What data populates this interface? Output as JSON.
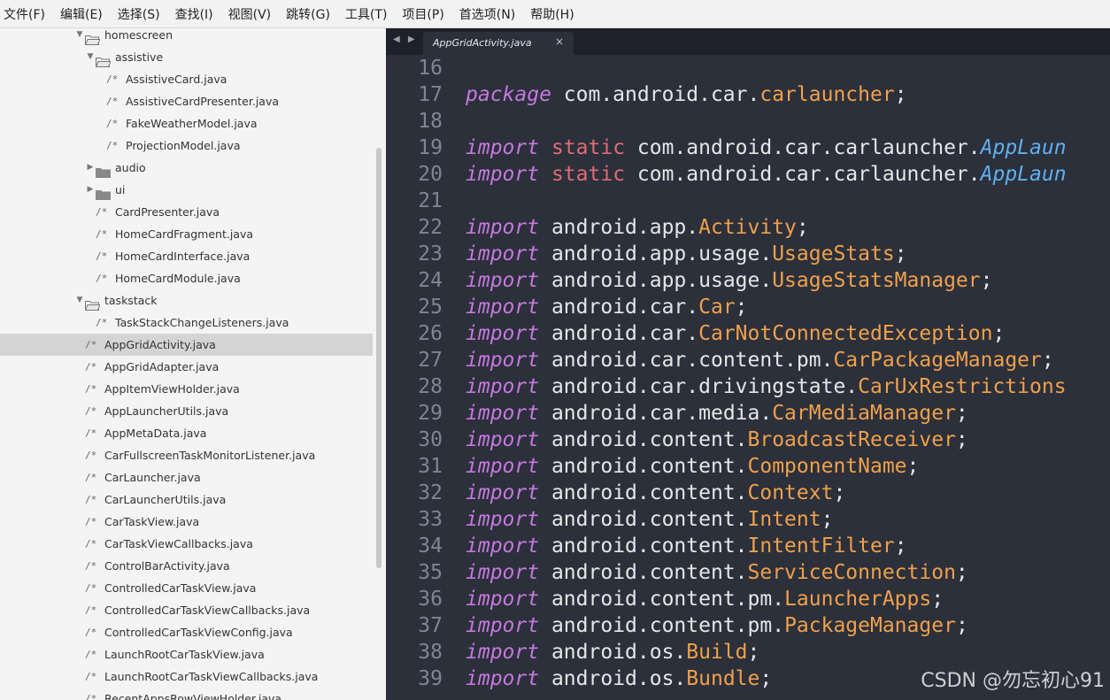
{
  "menu": [
    "文件(F)",
    "编辑(E)",
    "选择(S)",
    "查找(I)",
    "视图(V)",
    "跳转(G)",
    "工具(T)",
    "项目(P)",
    "首选项(N)",
    "帮助(H)"
  ],
  "sidebar": {
    "items": [
      {
        "type": "folder",
        "label": "homescreen",
        "indent": 1,
        "expanded": true
      },
      {
        "type": "folder",
        "label": "assistive",
        "indent": 2,
        "expanded": true
      },
      {
        "type": "file",
        "label": "AssistiveCard.java",
        "indent": 3
      },
      {
        "type": "file",
        "label": "AssistiveCardPresenter.java",
        "indent": 3
      },
      {
        "type": "file",
        "label": "FakeWeatherModel.java",
        "indent": 3
      },
      {
        "type": "file",
        "label": "ProjectionModel.java",
        "indent": 3
      },
      {
        "type": "folder",
        "label": "audio",
        "indent": 2,
        "expanded": false
      },
      {
        "type": "folder",
        "label": "ui",
        "indent": 2,
        "expanded": false
      },
      {
        "type": "file",
        "label": "CardPresenter.java",
        "indent": 2
      },
      {
        "type": "file",
        "label": "HomeCardFragment.java",
        "indent": 2
      },
      {
        "type": "file",
        "label": "HomeCardInterface.java",
        "indent": 2
      },
      {
        "type": "file",
        "label": "HomeCardModule.java",
        "indent": 2
      },
      {
        "type": "folder",
        "label": "taskstack",
        "indent": 1,
        "expanded": true
      },
      {
        "type": "file",
        "label": "TaskStackChangeListeners.java",
        "indent": 2
      },
      {
        "type": "file",
        "label": "AppGridActivity.java",
        "indent": 1,
        "selected": true
      },
      {
        "type": "file",
        "label": "AppGridAdapter.java",
        "indent": 1
      },
      {
        "type": "file",
        "label": "AppItemViewHolder.java",
        "indent": 1
      },
      {
        "type": "file",
        "label": "AppLauncherUtils.java",
        "indent": 1
      },
      {
        "type": "file",
        "label": "AppMetaData.java",
        "indent": 1
      },
      {
        "type": "file",
        "label": "CarFullscreenTaskMonitorListener.java",
        "indent": 1
      },
      {
        "type": "file",
        "label": "CarLauncher.java",
        "indent": 1
      },
      {
        "type": "file",
        "label": "CarLauncherUtils.java",
        "indent": 1
      },
      {
        "type": "file",
        "label": "CarTaskView.java",
        "indent": 1
      },
      {
        "type": "file",
        "label": "CarTaskViewCallbacks.java",
        "indent": 1
      },
      {
        "type": "file",
        "label": "ControlBarActivity.java",
        "indent": 1
      },
      {
        "type": "file",
        "label": "ControlledCarTaskView.java",
        "indent": 1
      },
      {
        "type": "file",
        "label": "ControlledCarTaskViewCallbacks.java",
        "indent": 1
      },
      {
        "type": "file",
        "label": "ControlledCarTaskViewConfig.java",
        "indent": 1
      },
      {
        "type": "file",
        "label": "LaunchRootCarTaskView.java",
        "indent": 1
      },
      {
        "type": "file",
        "label": "LaunchRootCarTaskViewCallbacks.java",
        "indent": 1
      },
      {
        "type": "file",
        "label": "RecentAppsRowViewHolder.java",
        "indent": 1
      }
    ],
    "file_mark": "/*"
  },
  "editor": {
    "tab_title": "AppGridActivity.java",
    "tab_close": "×",
    "nav_arrows": "◀ ▶",
    "lines": [
      {
        "n": "16",
        "t": []
      },
      {
        "n": "17",
        "t": [
          [
            "kw",
            "package"
          ],
          [
            "",
            "com.android.car."
          ],
          [
            "cls",
            "carlauncher"
          ],
          [
            "",
            ";"
          ]
        ]
      },
      {
        "n": "18",
        "t": []
      },
      {
        "n": "19",
        "t": [
          [
            "kw",
            "import"
          ],
          [
            "kw2",
            "static"
          ],
          [
            "",
            "com.android.car.carlauncher."
          ],
          [
            "fn",
            "AppLaun"
          ]
        ]
      },
      {
        "n": "20",
        "t": [
          [
            "kw",
            "import"
          ],
          [
            "kw2",
            "static"
          ],
          [
            "",
            "com.android.car.carlauncher."
          ],
          [
            "fn",
            "AppLaun"
          ]
        ]
      },
      {
        "n": "21",
        "t": []
      },
      {
        "n": "22",
        "t": [
          [
            "kw",
            "import"
          ],
          [
            "",
            "android.app."
          ],
          [
            "cls",
            "Activity"
          ],
          [
            "",
            ";"
          ]
        ]
      },
      {
        "n": "23",
        "t": [
          [
            "kw",
            "import"
          ],
          [
            "",
            "android.app.usage."
          ],
          [
            "cls",
            "UsageStats"
          ],
          [
            "",
            ";"
          ]
        ]
      },
      {
        "n": "24",
        "t": [
          [
            "kw",
            "import"
          ],
          [
            "",
            "android.app.usage."
          ],
          [
            "cls",
            "UsageStatsManager"
          ],
          [
            "",
            ";"
          ]
        ]
      },
      {
        "n": "25",
        "t": [
          [
            "kw",
            "import"
          ],
          [
            "",
            "android.car."
          ],
          [
            "cls",
            "Car"
          ],
          [
            "",
            ";"
          ]
        ]
      },
      {
        "n": "26",
        "t": [
          [
            "kw",
            "import"
          ],
          [
            "",
            "android.car."
          ],
          [
            "cls",
            "CarNotConnectedException"
          ],
          [
            "",
            ";"
          ]
        ]
      },
      {
        "n": "27",
        "t": [
          [
            "kw",
            "import"
          ],
          [
            "",
            "android.car.content.pm."
          ],
          [
            "cls",
            "CarPackageManager"
          ],
          [
            "",
            ";"
          ]
        ]
      },
      {
        "n": "28",
        "t": [
          [
            "kw",
            "import"
          ],
          [
            "",
            "android.car.drivingstate."
          ],
          [
            "cls",
            "CarUxRestrictions"
          ]
        ]
      },
      {
        "n": "29",
        "t": [
          [
            "kw",
            "import"
          ],
          [
            "",
            "android.car.media."
          ],
          [
            "cls",
            "CarMediaManager"
          ],
          [
            "",
            ";"
          ]
        ]
      },
      {
        "n": "30",
        "t": [
          [
            "kw",
            "import"
          ],
          [
            "",
            "android.content."
          ],
          [
            "cls",
            "BroadcastReceiver"
          ],
          [
            "",
            ";"
          ]
        ]
      },
      {
        "n": "31",
        "t": [
          [
            "kw",
            "import"
          ],
          [
            "",
            "android.content."
          ],
          [
            "cls",
            "ComponentName"
          ],
          [
            "",
            ";"
          ]
        ]
      },
      {
        "n": "32",
        "t": [
          [
            "kw",
            "import"
          ],
          [
            "",
            "android.content."
          ],
          [
            "cls",
            "Context"
          ],
          [
            "",
            ";"
          ]
        ]
      },
      {
        "n": "33",
        "t": [
          [
            "kw",
            "import"
          ],
          [
            "",
            "android.content."
          ],
          [
            "cls",
            "Intent"
          ],
          [
            "",
            ";"
          ]
        ]
      },
      {
        "n": "34",
        "t": [
          [
            "kw",
            "import"
          ],
          [
            "",
            "android.content."
          ],
          [
            "cls",
            "IntentFilter"
          ],
          [
            "",
            ";"
          ]
        ]
      },
      {
        "n": "35",
        "t": [
          [
            "kw",
            "import"
          ],
          [
            "",
            "android.content."
          ],
          [
            "cls",
            "ServiceConnection"
          ],
          [
            "",
            ";"
          ]
        ]
      },
      {
        "n": "36",
        "t": [
          [
            "kw",
            "import"
          ],
          [
            "",
            "android.content.pm."
          ],
          [
            "cls",
            "LauncherApps"
          ],
          [
            "",
            ";"
          ]
        ]
      },
      {
        "n": "37",
        "t": [
          [
            "kw",
            "import"
          ],
          [
            "",
            "android.content.pm."
          ],
          [
            "cls",
            "PackageManager"
          ],
          [
            "",
            ";"
          ]
        ]
      },
      {
        "n": "38",
        "t": [
          [
            "kw",
            "import"
          ],
          [
            "",
            "android.os."
          ],
          [
            "cls",
            "Build"
          ],
          [
            "",
            ";"
          ]
        ]
      },
      {
        "n": "39",
        "t": [
          [
            "kw",
            "import"
          ],
          [
            "",
            "android.os."
          ],
          [
            "cls",
            "Bundle"
          ],
          [
            "",
            ";"
          ]
        ]
      }
    ]
  },
  "watermark": "CSDN @勿忘初心91",
  "colors": {
    "editor_bg": "#2b303b",
    "keyword": "#c678dd",
    "static_kw": "#e06c75",
    "class_name": "#f0a04b",
    "func_ref": "#61afef",
    "selected_row": "#d4d4d4"
  }
}
